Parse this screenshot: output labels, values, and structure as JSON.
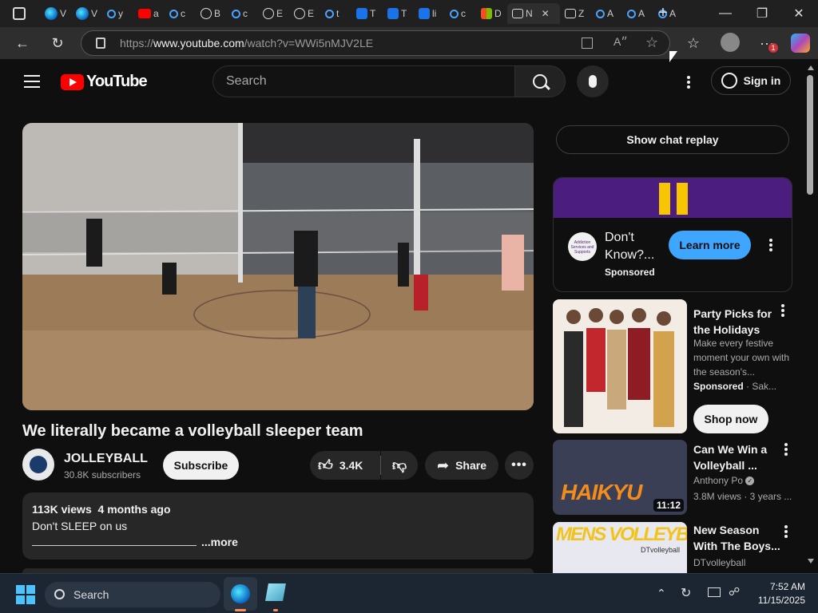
{
  "browser": {
    "tabs": [
      {
        "letter": "V",
        "icon": "edge-icon"
      },
      {
        "letter": "V",
        "icon": "edge-icon"
      },
      {
        "letter": "y",
        "icon": "search-icon"
      },
      {
        "letter": "a",
        "icon": "youtube-icon"
      },
      {
        "letter": "c",
        "icon": "search-icon"
      },
      {
        "letter": "B",
        "icon": "globe-icon"
      },
      {
        "letter": "c",
        "icon": "search-icon"
      },
      {
        "letter": "E",
        "icon": "globe-icon"
      },
      {
        "letter": "E",
        "icon": "globe-icon"
      },
      {
        "letter": "t",
        "icon": "search-icon"
      },
      {
        "letter": "T",
        "icon": "doc-icon"
      },
      {
        "letter": "T",
        "icon": "doc-icon"
      },
      {
        "letter": "li",
        "icon": "doc-icon"
      },
      {
        "letter": "c",
        "icon": "search-icon"
      },
      {
        "letter": "D",
        "icon": "microsoft-icon"
      },
      {
        "letter": "N",
        "icon": "mail-icon"
      },
      {
        "letter": "Z",
        "icon": "news-icon"
      },
      {
        "letter": "A",
        "icon": "search-icon"
      },
      {
        "letter": "A",
        "icon": "search-icon"
      },
      {
        "letter": "A",
        "icon": "search-icon"
      }
    ],
    "url_prefix": "https://",
    "url_host": "www.youtube.com",
    "url_path": "/watch?v=WWi5nMJV2LE",
    "notification_count": "1"
  },
  "yt": {
    "logo_text": "YouTube",
    "search_placeholder": "Search",
    "sign_in": "Sign in",
    "video": {
      "title": "We literally became a volleyball sleeper team",
      "channel": "JOLLEYBALL",
      "subscribers": "30.8K subscribers",
      "subscribe": "Subscribe",
      "likes": "3.4K",
      "share": "Share",
      "views": "113K views",
      "age": "4 months ago",
      "description": "Don't SLEEP on us",
      "more": "...more"
    },
    "chat_replay": "Show chat replay",
    "ad": {
      "title": "Don't Know?...",
      "sponsored": "Sponsored",
      "cta": "Learn more",
      "advertiser_logo_text": "Addiction Services and Supports"
    },
    "recommendations": [
      {
        "title": "Party Picks for the Holidays",
        "description": "Make every festive moment your own with the season's...",
        "meta": "Sponsored",
        "meta2": "Sak...",
        "cta": "Shop now"
      },
      {
        "title": "Can We Win a Volleyball ...",
        "channel": "Anthony Po",
        "meta": "3.8M views · 3 years ...",
        "duration": "11:12",
        "thumb_text": "HAIKYU"
      },
      {
        "title": "New Season With The Boys...",
        "channel": "DTvolleyball",
        "thumb_text": "MENS VOLLEYBALL",
        "thumb_sub": "DTvolleyball"
      }
    ]
  },
  "taskbar": {
    "search_label": "Search",
    "time": "7:52 AM",
    "date": "11/15/2025"
  },
  "colors": {
    "yt_red": "#ff0000",
    "learn_more": "#3ea6ff",
    "ad_banner": "#4b1d7e",
    "ad_bars": "#f7c600"
  }
}
